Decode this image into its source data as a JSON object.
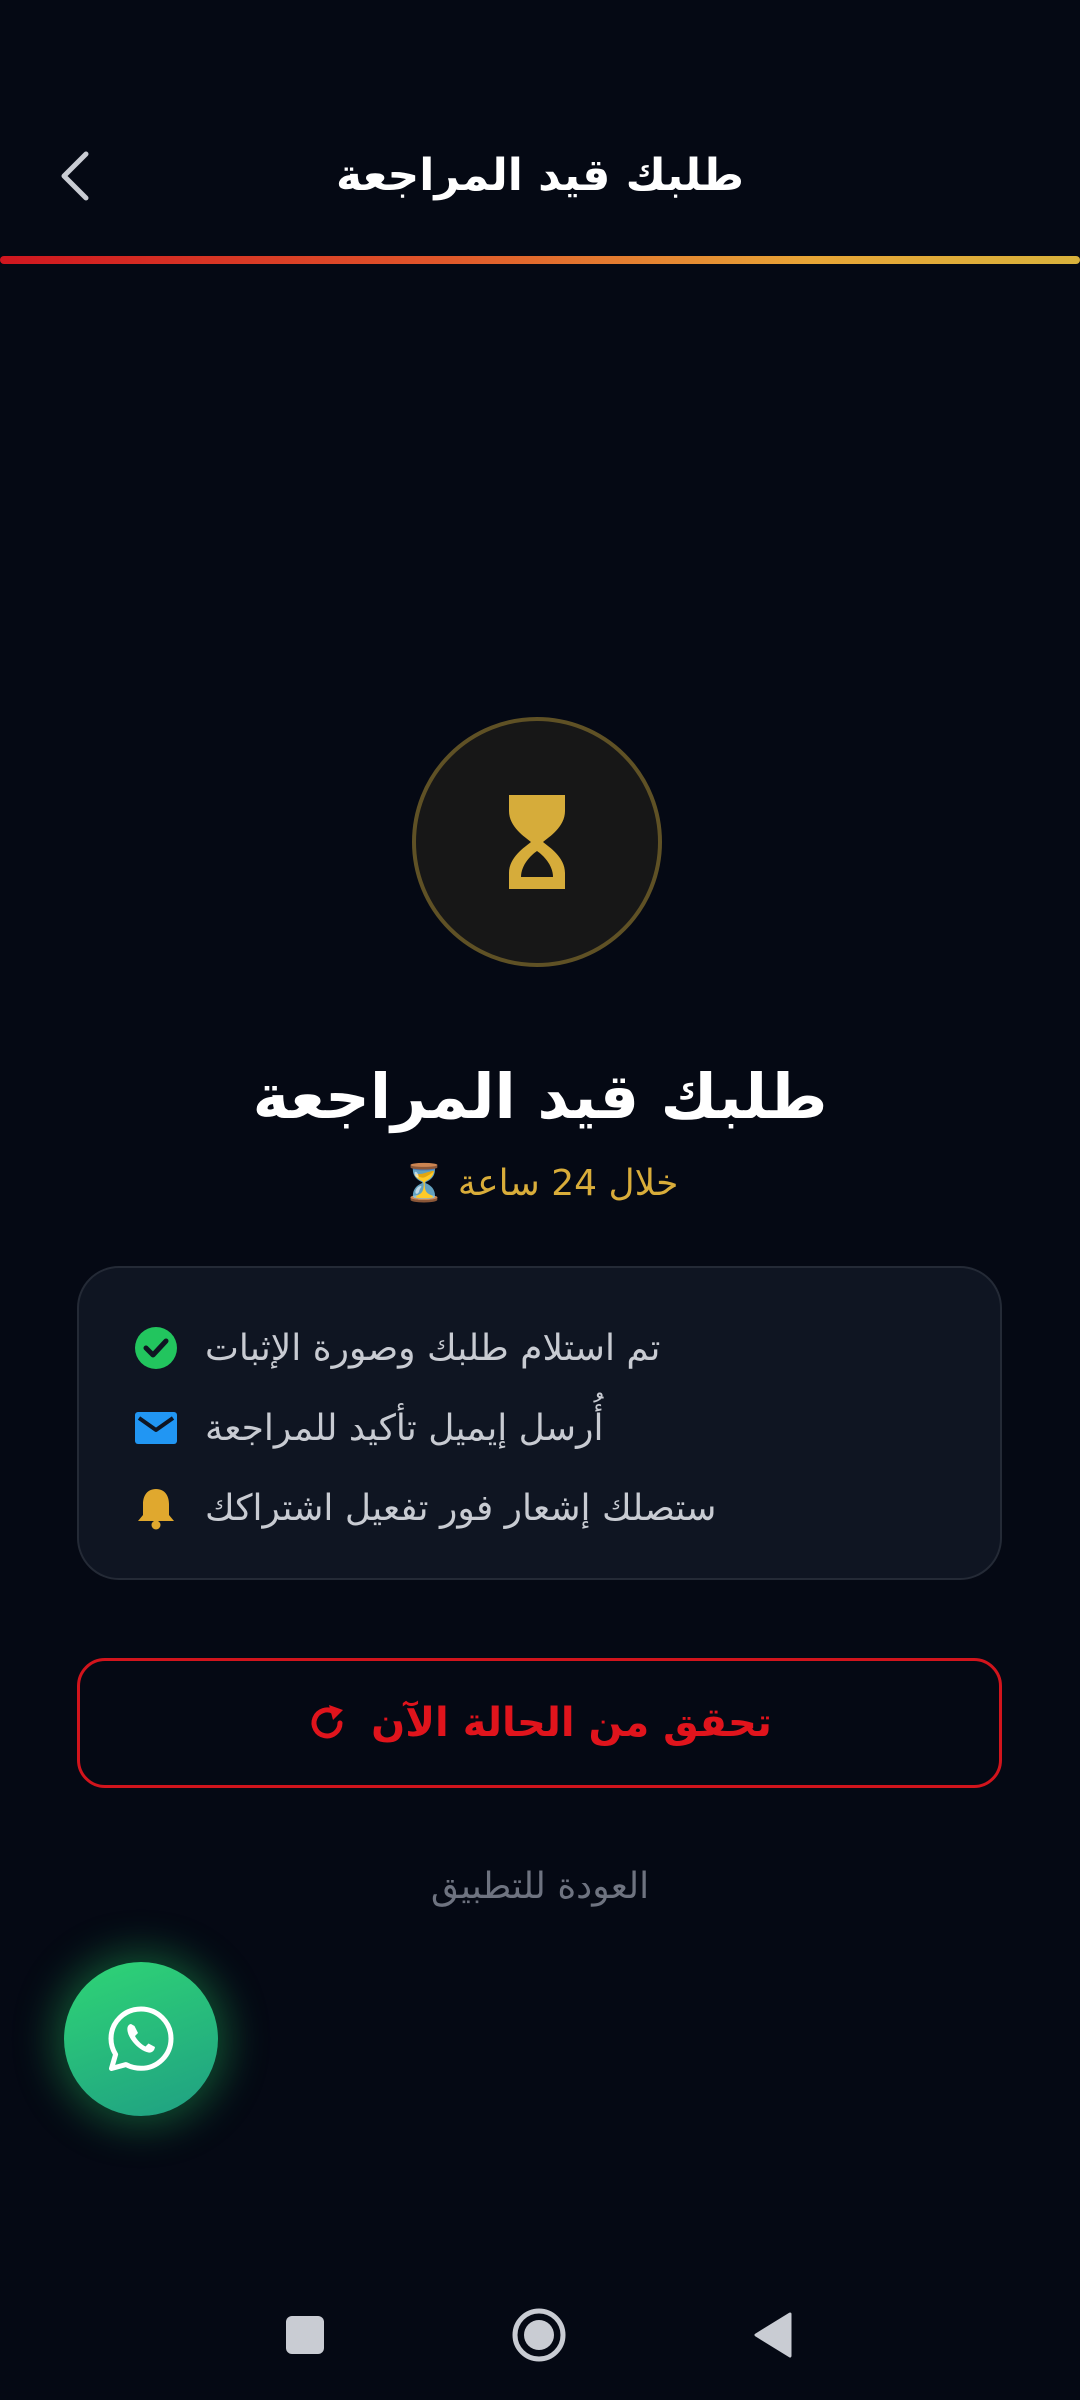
{
  "header": {
    "title": "طلبك قيد المراجعة",
    "back_icon": "chevron-left-icon"
  },
  "status": {
    "badge_icon": "hourglass-icon",
    "title": "طلبك قيد المراجعة",
    "subtitle": "خلال 24 ساعة ⏳"
  },
  "info_card": {
    "items": [
      {
        "icon": "check-circle-icon",
        "text": "تم استلام طلبك وصورة الإثبات"
      },
      {
        "icon": "mail-icon",
        "text": "أُرسل إيميل تأكيد للمراجعة"
      },
      {
        "icon": "bell-icon",
        "text": "ستصلك إشعار فور تفعيل اشتراكك"
      }
    ]
  },
  "actions": {
    "check_status_label": "تحقق من الحالة الآن",
    "back_to_app_label": "العودة للتطبيق"
  },
  "fab": {
    "icon": "whatsapp-icon"
  },
  "colors": {
    "background": "#050914",
    "accent_red": "#e0141c",
    "accent_gold": "#d9ad3a",
    "success_green": "#22c55e",
    "mail_blue": "#2196f3",
    "whatsapp_green": "#25d366"
  }
}
